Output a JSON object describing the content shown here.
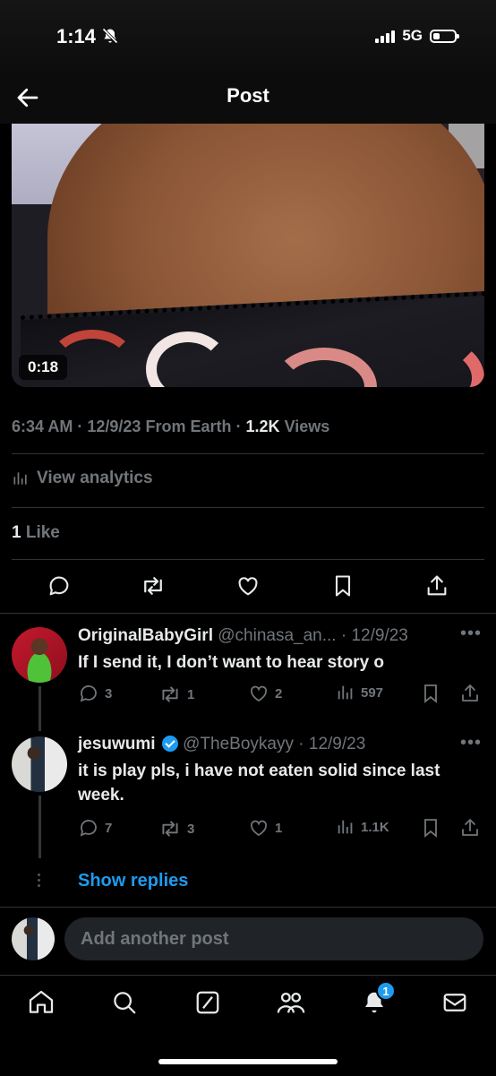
{
  "status_bar": {
    "time": "1:14",
    "network": "5G",
    "icons": [
      "silent-bell-icon",
      "signal-icon",
      "battery-icon"
    ]
  },
  "header": {
    "title": "Post",
    "back_icon": "arrow-left-icon"
  },
  "media": {
    "duration": "0:18"
  },
  "post_meta": {
    "time": "6:34 AM",
    "date": "12/9/23",
    "source": "From Earth",
    "views_count": "1.2K",
    "views_label": "Views",
    "sep": "·"
  },
  "analytics": {
    "label": "View analytics"
  },
  "likes": {
    "count": "1",
    "label": "Like"
  },
  "actions": [
    "reply-icon",
    "repost-icon",
    "like-icon",
    "bookmark-icon",
    "share-icon"
  ],
  "replies": [
    {
      "name": "OriginalBabyGirl",
      "handle": "@chinasa_an...",
      "date": "· 12/9/23",
      "text": "If I send it, I don’t want to hear story o",
      "reply_count": "3",
      "repost_count": "1",
      "like_count": "2",
      "view_count": "597"
    },
    {
      "name": "jesuwumi",
      "handle": "@TheBoykayy",
      "date": "· 12/9/23",
      "verified": true,
      "text": "it is play pls, i have not eaten solid since last week.",
      "reply_count": "7",
      "repost_count": "3",
      "like_count": "1",
      "view_count": "1.1K"
    }
  ],
  "show_replies": "Show replies",
  "compose": {
    "placeholder": "Add another post"
  },
  "tab_bar": {
    "items": [
      "home-icon",
      "search-icon",
      "grok-icon",
      "communities-icon",
      "notifications-icon",
      "messages-icon"
    ],
    "notification_badge": "1"
  },
  "colors": {
    "background": "#000000",
    "accent": "#1d9bf0",
    "secondary_text": "#71767b",
    "divider": "#2f3336"
  }
}
